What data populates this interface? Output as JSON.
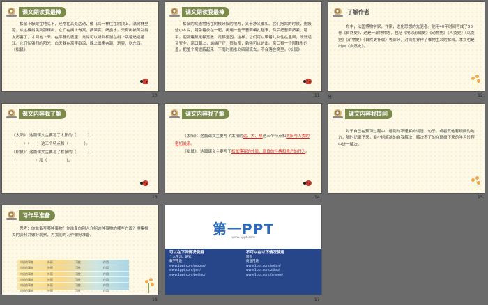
{
  "slides": [
    {
      "number": "10",
      "title": "课文朗读我最棒",
      "text": "松鼠不躲藏在地底下，经常在高处活动，像飞鸟一样住在树顶上，满树林里跑，从这棵树跳到那棵树，它们在树上做窝，摘果实，喝露水。只有树被风刮得太厉害了，才到地上来。在平静的夜里，常常可以听到松鼠在树上跳着追逐嬉戏。它们怕强烈的阳光，白天躲在窝里歇凉，晚上出来奔跑、玩耍、吃东西。《松鼠》"
    },
    {
      "number": "11",
      "title": "课文朗读我最棒",
      "text": "松鼠的窝通常搭在树枝分杈的地方，又干净又暖和。它们搭窝的时候，先搬些小木片，错杂着放在一起，再用一些干苔藓编扎起来，然后把苔藓挤紧、踏平，使那建筑足够宽敞，足够坚固。这样，它们可以带着儿女住在里面，既舒适又安全。窝口朝上，端端正正，很狭窄，勉强可以进出。窝口有一个圆锥形的盖，把整个窝遮蔽起来，下雨时雨水向四周流去，不会落在窝里。《松鼠》"
    },
    {
      "number": "12",
      "title": "了解作者",
      "text": "布丰，法国博物学家，作家，进化思想的先驱者。他用40年时间写成了36卷《自然史》，这是一部博物志，包括《地球形成史》《动物史》《人类史》《鸟类史》《矿物史》《自然史补编》等部分，对自然界作了唯物主义的解释。本文也是出自《自然史》。"
    },
    {
      "number": "13",
      "title": "课文内容我了解",
      "lines": [
        "《太阳》：这篇课文主要写了太阳的（　　　），",
        "（　　）（　　）这三个特点和（　　　　）。",
        "《松鼠》：这篇课文主要写了松鼠的（　　　），",
        "（　　　　　）和（　　　　　）。"
      ]
    },
    {
      "number": "14",
      "title": "课文内容我了解",
      "line1_pre": "《太阳》：这篇课文主要写了太阳的",
      "line1_red": "远、大、热",
      "line1_post": "这三个特点和",
      "line1_red2": "太阳与人类的密切关系",
      "line1_end": "。",
      "line2_pre": "《松鼠》：这篇课文主要写了",
      "line2_red": "松鼠漂亮的外表、驯良的性格和乖巧的行为",
      "line2_end": "。"
    },
    {
      "number": "15",
      "title": "课文内容我提问",
      "text": "对于自己在预习过程中，遇到的不理解的词语、句子，或者其他有疑问的地方，随时记录下来，能小组解决的自我解决，解决不了的在班级下来的学习过程中进一解决。"
    },
    {
      "number": "16",
      "title": "习作早准备",
      "text": "思考：你准备写哪种事物？你准备向别人介绍这种事物的哪些方面？搜集相关的资料并做好观察，为我们的习作做好准备。",
      "table": [
        [
          "介绍的事物",
          "外形",
          "习性",
          "作用"
        ],
        [
          "介绍的事物",
          "外形",
          "习性",
          "作用"
        ],
        [
          "介绍的事物",
          "外形",
          "习性",
          "作用"
        ],
        [
          "介绍的事物",
          "外形",
          "习性",
          "作用"
        ],
        [
          "介绍的事物",
          "外形",
          "习性",
          "作用"
        ],
        [
          "介绍的事物",
          "外形",
          "习性",
          "作用"
        ]
      ]
    },
    {
      "number": "17",
      "logo": "第一PPT",
      "url": "www.1ppt.com",
      "col1_title": "可以在下列情况使用",
      "col1_items": [
        "个人学习、研究",
        "教学用途",
        "www.1ppt.com/moban/",
        "www.1ppt.com/jieri/",
        "www.1ppt.com/beijing/"
      ],
      "col2_title": "不可以在以下情况使用",
      "col2_items": [
        "转售",
        "商业用途",
        "www.1ppt.com/kejian/",
        "www.1ppt.com/ziliao/",
        "www.1ppt.com/fanwen/"
      ]
    }
  ],
  "side_label": "分"
}
